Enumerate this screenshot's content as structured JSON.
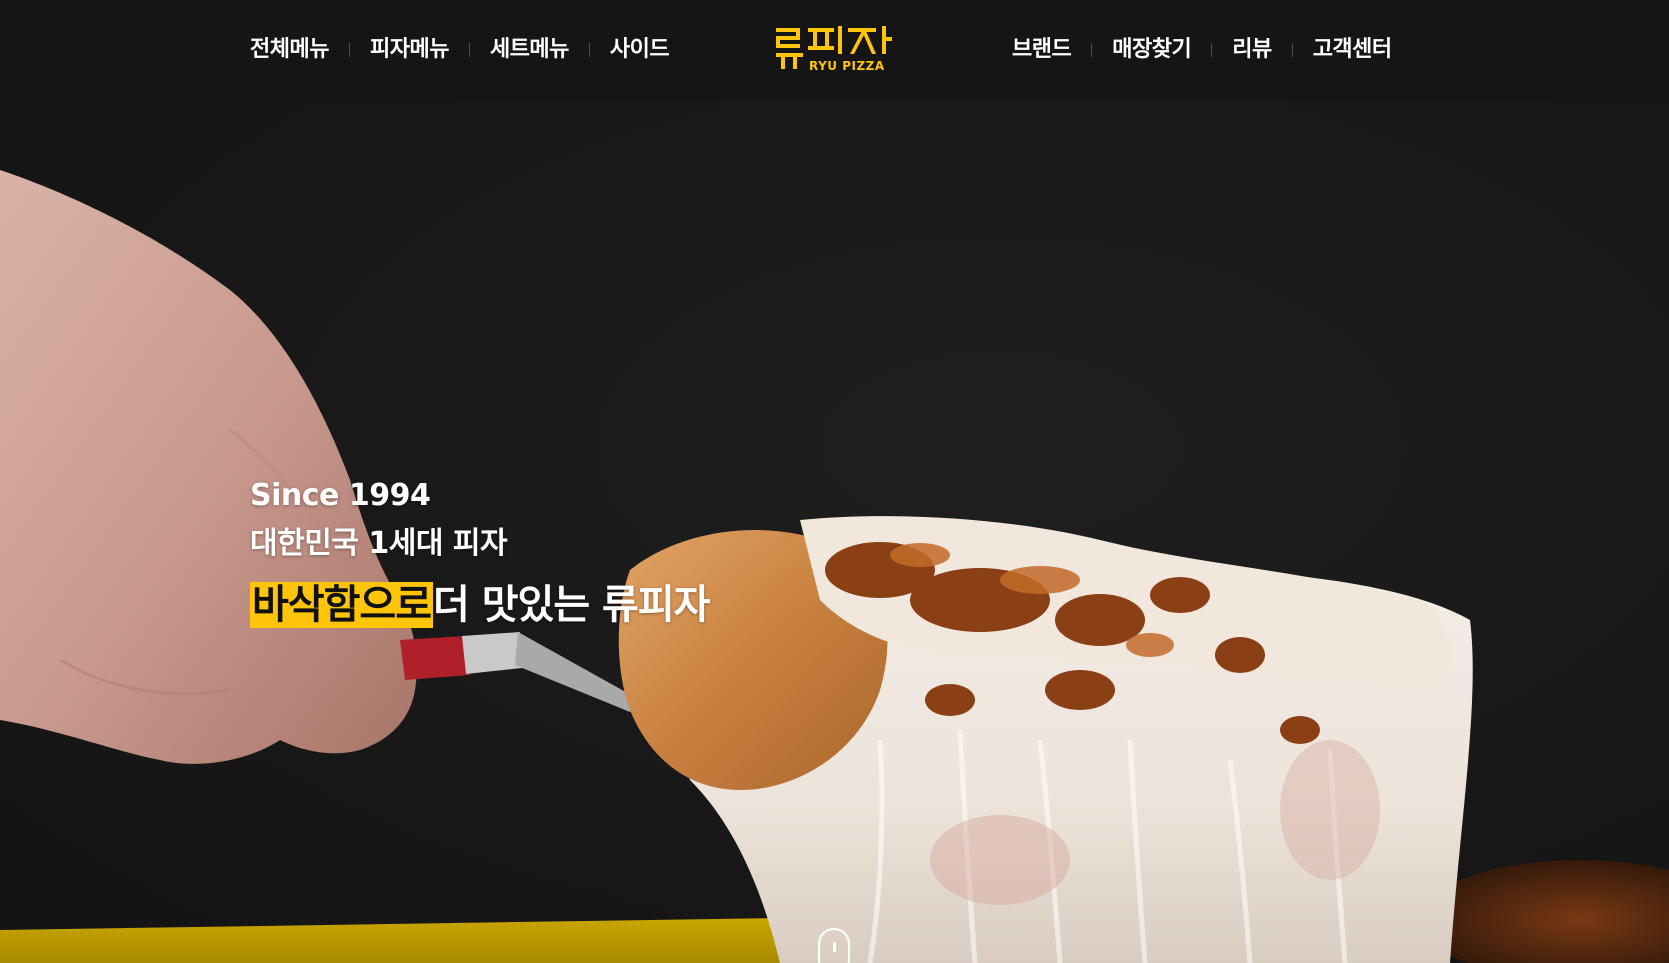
{
  "nav_left": [
    {
      "label": "전체메뉴"
    },
    {
      "label": "피자메뉴"
    },
    {
      "label": "세트메뉴"
    },
    {
      "label": "사이드"
    }
  ],
  "nav_right": [
    {
      "label": "브랜드"
    },
    {
      "label": "매장찾기"
    },
    {
      "label": "리뷰"
    },
    {
      "label": "고객센터"
    }
  ],
  "logo": {
    "korean": "류피자",
    "english": "RYU PIZZA",
    "color": "#ffc50a"
  },
  "hero": {
    "since": "Since 1994",
    "first_generation": "대한민국 1세대 피자",
    "tagline_highlight": "바삭함으로",
    "tagline_rest": "더 맛있는 류피자",
    "highlight_color": "#ffc50a"
  },
  "scroll_indicator": {
    "icon": "mouse-scroll-icon"
  }
}
